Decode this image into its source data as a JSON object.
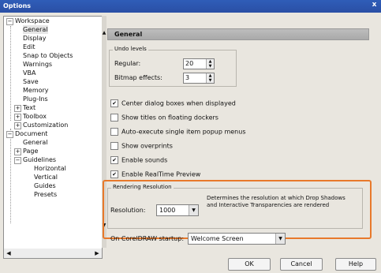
{
  "window": {
    "title": "Options",
    "close_glyph": "x"
  },
  "tree": {
    "workspace": "Workspace",
    "general": "General",
    "display": "Display",
    "edit": "Edit",
    "snap": "Snap to Objects",
    "warnings": "Warnings",
    "vba": "VBA",
    "save": "Save",
    "memory": "Memory",
    "plugins": "Plug-Ins",
    "text": "Text",
    "toolbox": "Toolbox",
    "customization": "Customization",
    "document": "Document",
    "doc_general": "General",
    "page": "Page",
    "guidelines": "Guidelines",
    "horizontal": "Horizontal",
    "vertical": "Vertical",
    "guides": "Guides",
    "presets": "Presets"
  },
  "header": {
    "title": "General"
  },
  "undo": {
    "group_label": "Undo levels",
    "regular_label": "Regular:",
    "regular_value": "20",
    "bitmap_label": "Bitmap effects:",
    "bitmap_value": "3"
  },
  "checkboxes": [
    {
      "label": "Center dialog boxes when displayed",
      "checked": true
    },
    {
      "label": "Show titles on floating dockers",
      "checked": false
    },
    {
      "label": "Auto-execute single item popup menus",
      "checked": false
    },
    {
      "label": "Show overprints",
      "checked": false
    },
    {
      "label": "Enable sounds",
      "checked": true
    },
    {
      "label": "Enable RealTime Preview",
      "checked": true
    }
  ],
  "rendering": {
    "group_label": "Rendering Resolution",
    "resolution_label": "Resolution:",
    "resolution_value": "1000",
    "description": "Determines the resolution at which Drop Shadows and Interactive Transparencies are rendered"
  },
  "startup": {
    "label": "On CorelDRAW startup:",
    "value": "Welcome Screen"
  },
  "buttons": {
    "ok": "OK",
    "cancel": "Cancel",
    "help": "Help"
  },
  "colors": {
    "titlebar": "#2f5db8",
    "highlight": "#e8792b"
  }
}
